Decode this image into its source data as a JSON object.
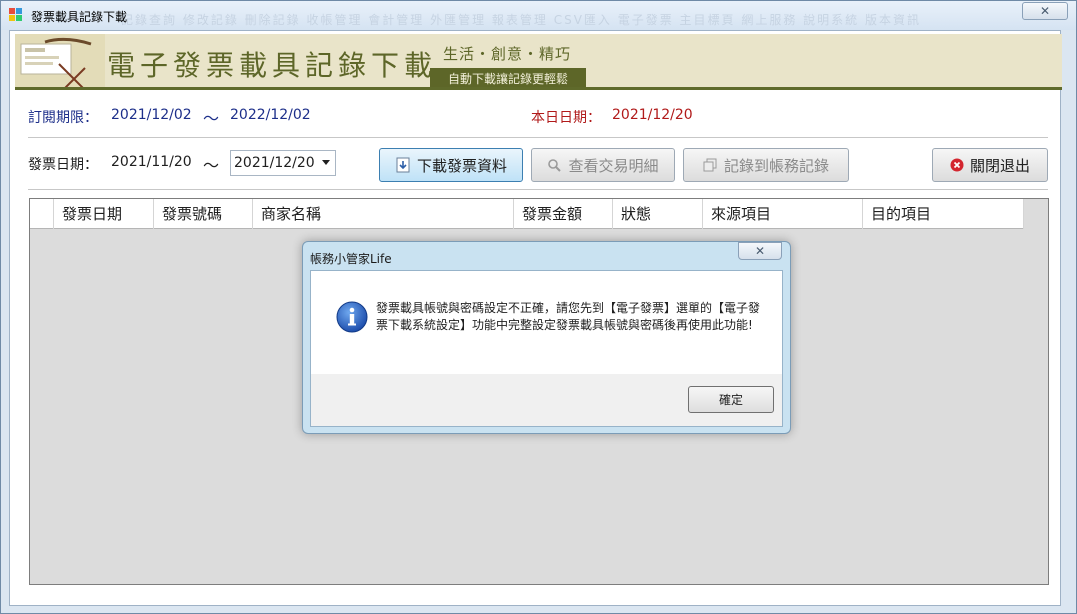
{
  "window": {
    "title": "發票載具記錄下載",
    "close_symbol": "✕",
    "ghost_menu": "記錄查詢  修改記錄  刪除記錄  收帳管理  會計管理  外匯管理  報表管理  CSV匯入  電子發票  主目標頁  網上服務  說明系統  版本資訊"
  },
  "banner": {
    "title": "電子發票載具記錄下載",
    "slogan": "生活・創意・精巧",
    "tag": "自動下載讓記錄更輕鬆"
  },
  "subscription": {
    "label": "訂閱期限：",
    "start": "2021/12/02",
    "tilde": "～",
    "end": "2022/12/02"
  },
  "today": {
    "label": "本日日期：",
    "value": "2021/12/20"
  },
  "invoice_date": {
    "label": "發票日期：",
    "start": "2021/11/20",
    "tilde": "～",
    "end": "2021/12/20"
  },
  "buttons": {
    "download": "下載發票資料",
    "view_details": "查看交易明細",
    "record": "記錄到帳務記錄",
    "exit": "關閉退出"
  },
  "grid": {
    "columns": [
      "發票日期",
      "發票號碼",
      "商家名稱",
      "發票金額",
      "狀態",
      "來源項目",
      "目的項目"
    ]
  },
  "dialog": {
    "title": "帳務小管家Life",
    "close_symbol": "✕",
    "message": "發票載具帳號與密碼設定不正確，請您先到【電子發票】選單的【電子發票下載系統設定】功能中完整設定發票載具帳號與密碼後再使用此功能!",
    "ok": "確定"
  },
  "colors": {
    "banner_olive": "#5d6628",
    "banner_bg": "#e9e4c9",
    "subscription_text": "#1d2f8a",
    "today_text": "#b11a1a",
    "dialog_frame": "#c9e2f1"
  }
}
